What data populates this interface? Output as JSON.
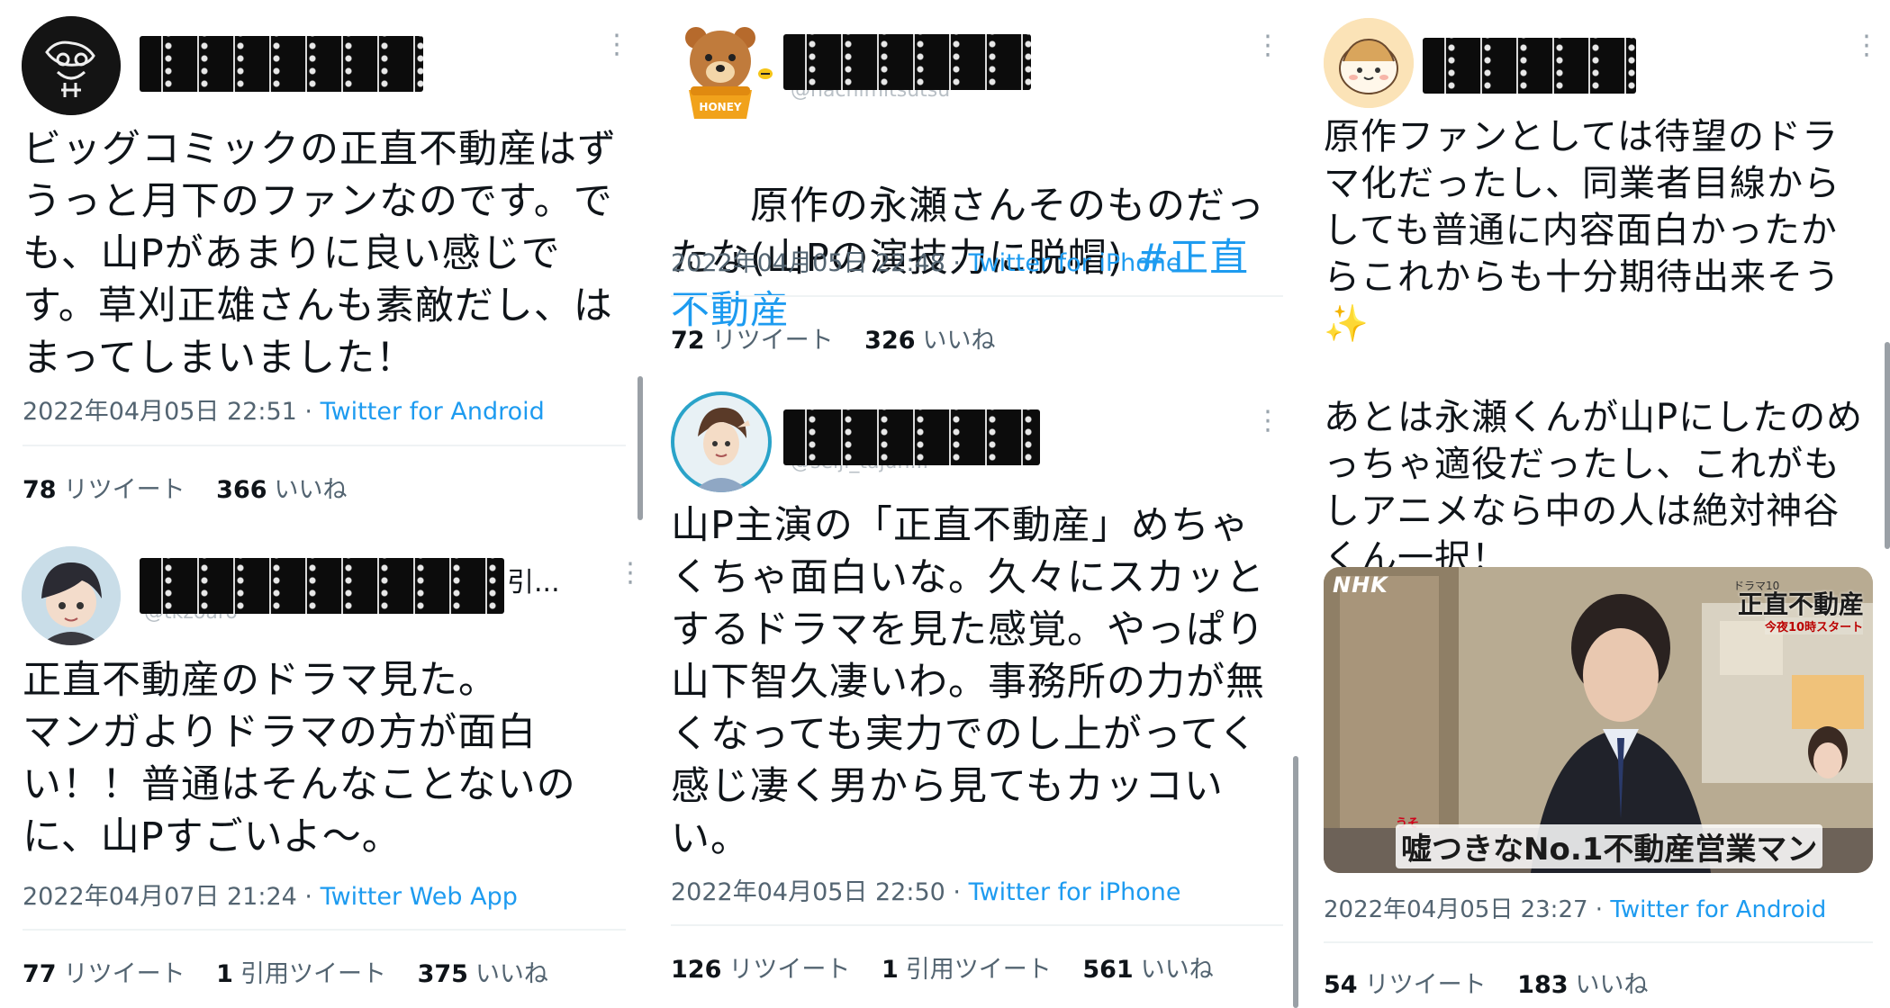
{
  "tweets": {
    "t1": {
      "text": "ビッグコミックの正直不動産はずうっと月下のファンなのです。でも、山Pがあまりに良い感じです。草刈正雄さんも素敵だし、はまってしまいました！",
      "date": "2022年04月05日 22:51",
      "source": "Twitter for Android",
      "retweets": "78",
      "retweets_label": "リツイート",
      "likes": "366",
      "likes_label": "いいね"
    },
    "t2": {
      "name_suffix": "引...",
      "handle_fragment": "@tkzoaro",
      "text": "正直不動産のドラマ見た。\nマンガよりドラマの方が面白い！！普通はそんなことないのに、山Pすごいよ〜。",
      "date": "2022年04月07日 21:24",
      "source": "Twitter Web App",
      "retweets": "77",
      "retweets_label": "リツイート",
      "quotes": "1",
      "quotes_label": "引用ツイート",
      "likes": "375",
      "likes_label": "いいね"
    },
    "t3": {
      "handle_fragment": "@hachimitsutsu",
      "text_plain": "原作の永瀬さんそのものだったな(山Pの演技力に脱帽) ",
      "hashtag": "#正直不動産",
      "date": "2022年04月05日 22:48",
      "source": "Twitter for iPhone",
      "retweets": "72",
      "retweets_label": "リツイート",
      "likes": "326",
      "likes_label": "いいね"
    },
    "t4": {
      "handle_fragment": "@seiji_tajun...",
      "text": "山P主演の「正直不動産」めちゃくちゃ面白いな。久々にスカッとするドラマを見た感覚。やっぱり山下智久凄いわ。事務所の力が無くなっても実力でのし上がってく感じ凄く男から見てもカッコいい。",
      "date": "2022年04月05日 22:50",
      "source": "Twitter for iPhone",
      "retweets": "126",
      "retweets_label": "リツイート",
      "quotes": "1",
      "quotes_label": "引用ツイート",
      "likes": "561",
      "likes_label": "いいね"
    },
    "t5": {
      "text": "原作ファンとしては待望のドラマ化だったし、同業者目線からしても普通に内容面白かったからこれからも十分期待出来そう✨\n\nあとは永瀬くんが山Pにしたのめっちゃ適役だったし、これがもしアニメなら中の人は絶対神谷くん一択！",
      "media": {
        "channel_logo": "NHK",
        "drama_tag": "ドラマ10",
        "show_title": "正直不動産",
        "broadcast": "今夜10時スタート",
        "caption_ruby": "うそ",
        "caption": "嘘つきなNo.1不動産営業マン"
      },
      "date": "2022年04月05日 23:27",
      "source": "Twitter for Android",
      "retweets": "54",
      "retweets_label": "リツイート",
      "likes": "183",
      "likes_label": "いいね"
    }
  },
  "separator": " · ",
  "more_glyph": "⋮",
  "colors": {
    "link": "#1d9bf0",
    "meta": "#536471",
    "text": "#0f1419"
  }
}
